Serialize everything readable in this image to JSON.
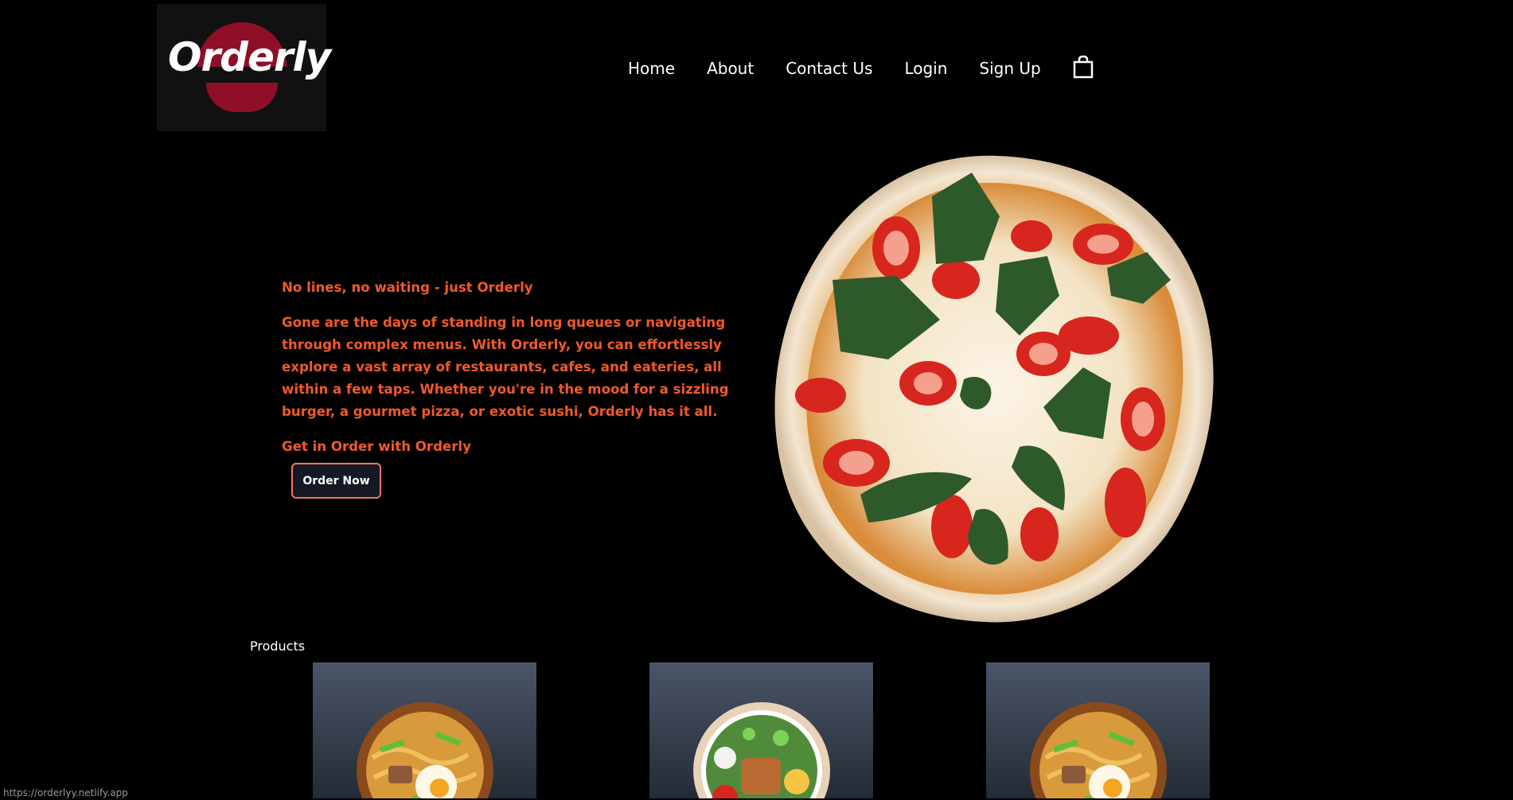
{
  "header": {
    "logo_text": "Orderly",
    "nav": [
      "Home",
      "About",
      "Contact Us",
      "Login",
      "Sign Up"
    ],
    "cart_icon": "shopping-bag-icon"
  },
  "hero": {
    "tagline": "No lines, no waiting - just Orderly",
    "body": "Gone are the days of standing in long queues or navigating through complex menus. With Orderly, you can effortlessly explore a vast array of restaurants, cafes, and eateries, all within a few taps. Whether you're in the mood for a sizzling burger, a gourmet pizza, or exotic sushi, Orderly has it all.",
    "cta_text": "Get in Order with Orderly",
    "button_label": "Order Now"
  },
  "products": {
    "label": "Products"
  },
  "status_bar": {
    "url": "https://orderlyy.netlify.app"
  },
  "colors": {
    "background": "#000000",
    "accent": "#f05a28",
    "logo_red": "#8f0f27"
  }
}
